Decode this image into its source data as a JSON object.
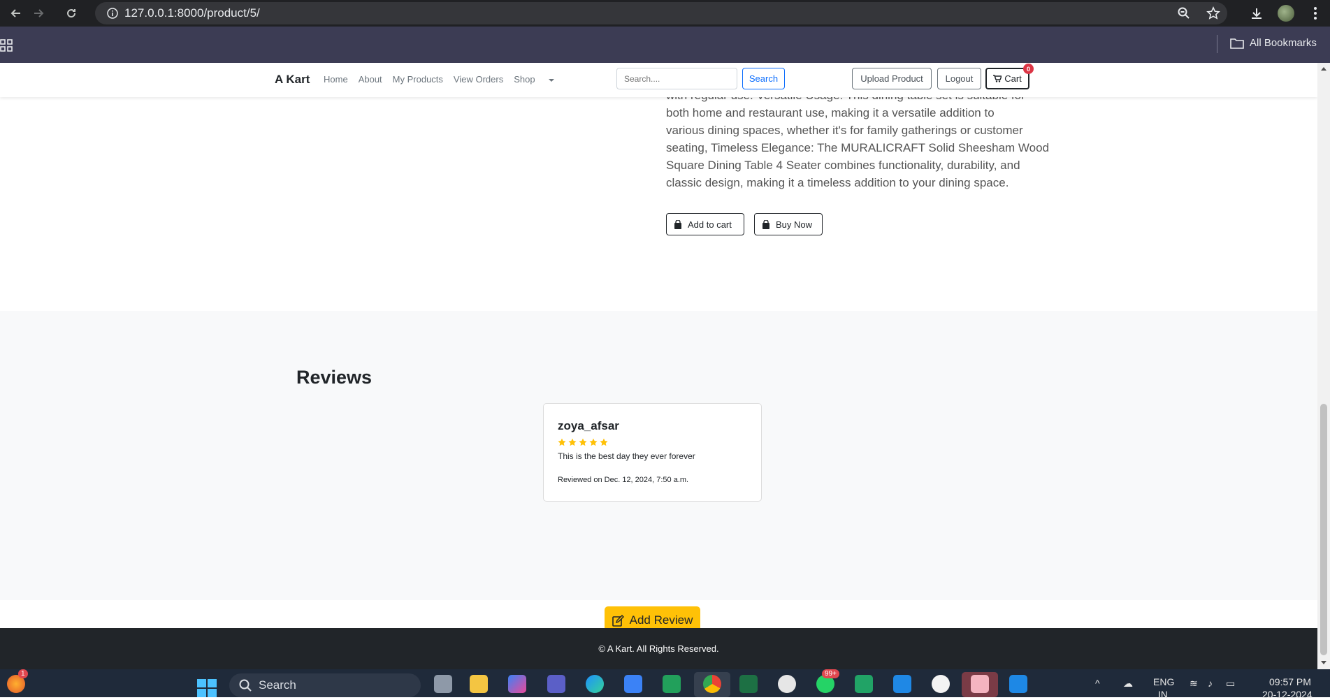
{
  "browser": {
    "url": "127.0.0.1:8000/product/5/",
    "bookmarks_label": "All Bookmarks"
  },
  "navbar": {
    "brand": "A Kart",
    "links": [
      "Home",
      "About",
      "My Products",
      "View Orders",
      "Shop"
    ],
    "search_placeholder": "Search....",
    "search_button": "Search",
    "upload_button": "Upload Product",
    "logout_button": "Logout",
    "cart_button": "Cart",
    "cart_count": "0"
  },
  "product": {
    "description_lines": [
      "with regular use. Versatile Usage: This dining table set is suitable for",
      "both home and restaurant use, making it a versatile addition to",
      "various dining spaces, whether it's for family gatherings or customer",
      "seating, Timeless Elegance: The MURALICRAFT Solid Sheesham Wood",
      "Square Dining Table 4 Seater combines functionality, durability, and",
      "classic design, making it a timeless addition to your dining space."
    ],
    "add_to_cart": "Add to cart",
    "buy_now": "Buy Now"
  },
  "reviews": {
    "title": "Reviews",
    "items": [
      {
        "user": "zoya_afsar",
        "rating": 5,
        "text": "This is the best day they ever forever",
        "date": "Reviewed on Dec. 12, 2024, 7:50 a.m."
      }
    ],
    "add_review": "Add Review",
    "star_color": "#ffc107"
  },
  "footer": {
    "text": "© A Kart. All Rights Reserved."
  },
  "taskbar": {
    "search": "Search",
    "lang_top": "ENG",
    "lang_bottom": "IN",
    "time": "09:57 PM",
    "date": "20-12-2024",
    "whatsapp_badge": "99+",
    "firefox_badge": "1"
  }
}
